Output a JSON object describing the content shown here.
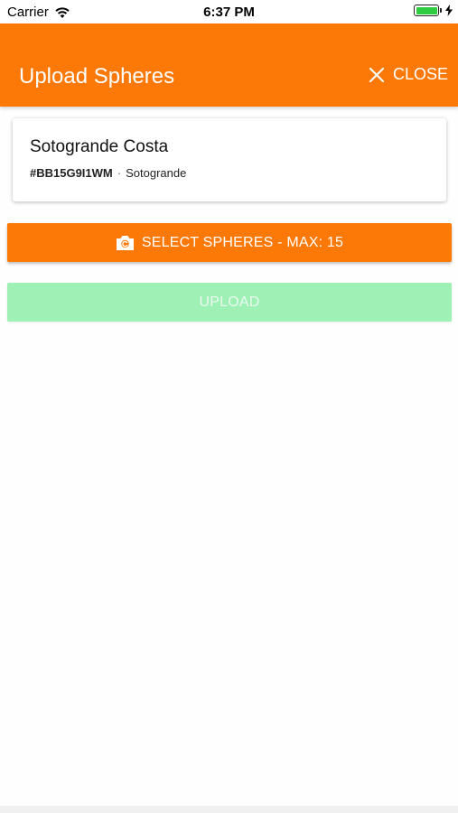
{
  "status_bar": {
    "carrier": "Carrier",
    "time": "6:37 PM",
    "battery_level": 1.0
  },
  "header": {
    "title": "Upload Spheres",
    "close_label": "CLOSE"
  },
  "card": {
    "title": "Sotogrande Costa",
    "code": "#BB15G9I1WM",
    "separator": "·",
    "location": "Sotogrande"
  },
  "actions": {
    "select_label": "SELECT SPHERES - MAX: 15",
    "upload_label": "UPLOAD"
  },
  "colors": {
    "accent": "#fc7907",
    "upload_disabled": "#9ff0b5",
    "battery": "#2ecc40"
  },
  "icons": {
    "status": [
      "wifi-icon",
      "battery-icon",
      "charging-icon"
    ],
    "header": [
      "close-icon"
    ],
    "select_button": [
      "camera-icon"
    ]
  }
}
